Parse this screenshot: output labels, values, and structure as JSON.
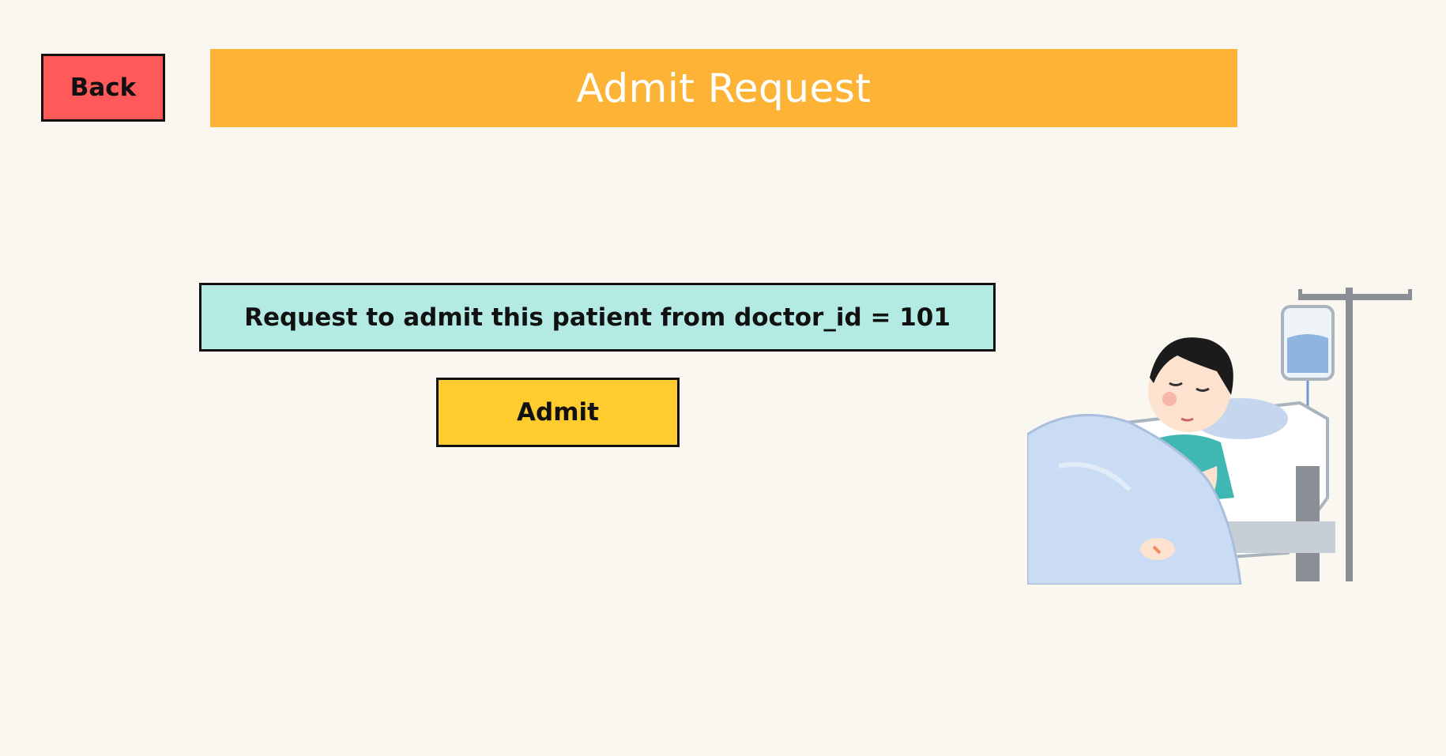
{
  "header": {
    "back_label": "Back",
    "title": "Admit Request"
  },
  "request": {
    "message": "Request to admit this patient from doctor_id = 101"
  },
  "actions": {
    "admit_label": "Admit"
  },
  "illustration": {
    "icon": "patient-in-hospital-bed-icon"
  },
  "colors": {
    "background": "#faf7f0",
    "back_button": "#ff5a5a",
    "title_bar": "#fdb335",
    "request_box": "#b3ebe4",
    "admit_button": "#ffcc2f"
  }
}
